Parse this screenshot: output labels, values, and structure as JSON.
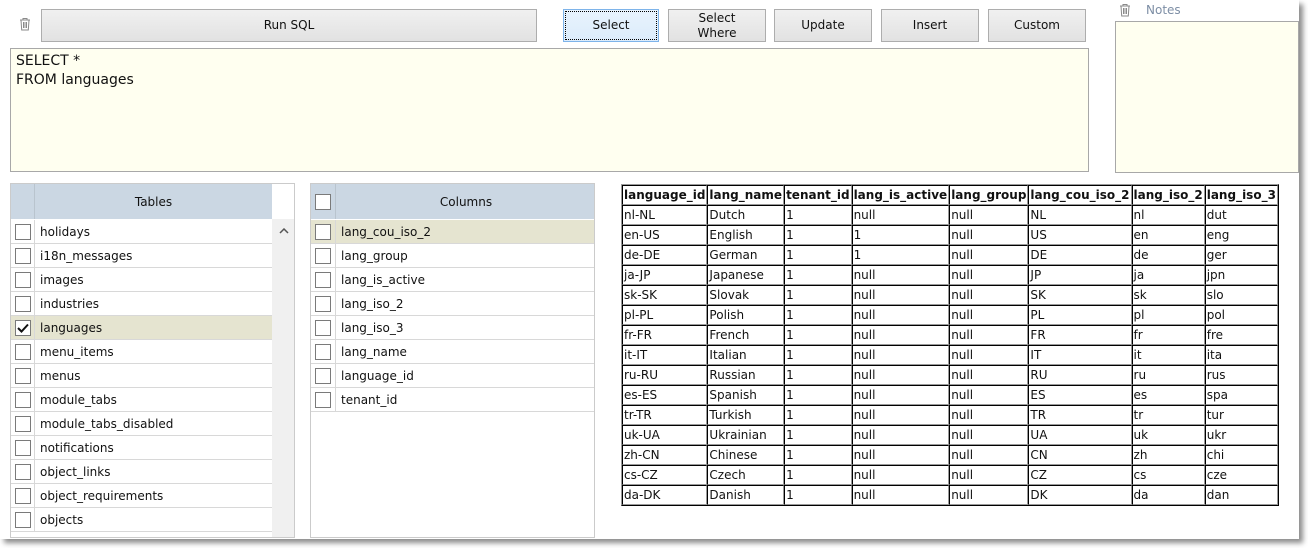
{
  "toolbar": {
    "clear_sql_icon": "trash-icon",
    "run_sql_label": "Run SQL",
    "templates": [
      {
        "label": "Select",
        "active": true
      },
      {
        "label": "Select\nWhere",
        "active": false
      },
      {
        "label": "Update",
        "active": false
      },
      {
        "label": "Insert",
        "active": false
      },
      {
        "label": "Custom",
        "active": false
      }
    ]
  },
  "editor": {
    "sql": "SELECT *\nFROM languages"
  },
  "notes": {
    "clear_icon": "trash-icon",
    "label": "Notes",
    "value": ""
  },
  "tables_panel": {
    "header": "Tables",
    "scroll_up_icon": "chevron-up-icon",
    "items": [
      {
        "name": "holidays",
        "checked": false,
        "selected": false
      },
      {
        "name": "i18n_messages",
        "checked": false,
        "selected": false
      },
      {
        "name": "images",
        "checked": false,
        "selected": false
      },
      {
        "name": "industries",
        "checked": false,
        "selected": false
      },
      {
        "name": "languages",
        "checked": true,
        "selected": true
      },
      {
        "name": "menu_items",
        "checked": false,
        "selected": false
      },
      {
        "name": "menus",
        "checked": false,
        "selected": false
      },
      {
        "name": "module_tabs",
        "checked": false,
        "selected": false
      },
      {
        "name": "module_tabs_disabled",
        "checked": false,
        "selected": false
      },
      {
        "name": "notifications",
        "checked": false,
        "selected": false
      },
      {
        "name": "object_links",
        "checked": false,
        "selected": false
      },
      {
        "name": "object_requirements",
        "checked": false,
        "selected": false
      },
      {
        "name": "objects",
        "checked": false,
        "selected": false
      }
    ]
  },
  "columns_panel": {
    "header": "Columns",
    "select_all_checked": false,
    "items": [
      {
        "name": "lang_cou_iso_2",
        "checked": false,
        "selected": true
      },
      {
        "name": "lang_group",
        "checked": false,
        "selected": false
      },
      {
        "name": "lang_is_active",
        "checked": false,
        "selected": false
      },
      {
        "name": "lang_iso_2",
        "checked": false,
        "selected": false
      },
      {
        "name": "lang_iso_3",
        "checked": false,
        "selected": false
      },
      {
        "name": "lang_name",
        "checked": false,
        "selected": false
      },
      {
        "name": "language_id",
        "checked": false,
        "selected": false
      },
      {
        "name": "tenant_id",
        "checked": false,
        "selected": false
      }
    ]
  },
  "results": {
    "columns": [
      "language_id",
      "lang_name",
      "tenant_id",
      "lang_is_active",
      "lang_group",
      "lang_cou_iso_2",
      "lang_iso_2",
      "lang_iso_3"
    ],
    "rows": [
      [
        "nl-NL",
        "Dutch",
        "1",
        "null",
        "null",
        "NL",
        "nl",
        "dut"
      ],
      [
        "en-US",
        "English",
        "1",
        "1",
        "null",
        "US",
        "en",
        "eng"
      ],
      [
        "de-DE",
        "German",
        "1",
        "1",
        "null",
        "DE",
        "de",
        "ger"
      ],
      [
        "ja-JP",
        "Japanese",
        "1",
        "null",
        "null",
        "JP",
        "ja",
        "jpn"
      ],
      [
        "sk-SK",
        "Slovak",
        "1",
        "null",
        "null",
        "SK",
        "sk",
        "slo"
      ],
      [
        "pl-PL",
        "Polish",
        "1",
        "null",
        "null",
        "PL",
        "pl",
        "pol"
      ],
      [
        "fr-FR",
        "French",
        "1",
        "null",
        "null",
        "FR",
        "fr",
        "fre"
      ],
      [
        "it-IT",
        "Italian",
        "1",
        "null",
        "null",
        "IT",
        "it",
        "ita"
      ],
      [
        "ru-RU",
        "Russian",
        "1",
        "null",
        "null",
        "RU",
        "ru",
        "rus"
      ],
      [
        "es-ES",
        "Spanish",
        "1",
        "null",
        "null",
        "ES",
        "es",
        "spa"
      ],
      [
        "tr-TR",
        "Turkish",
        "1",
        "null",
        "null",
        "TR",
        "tr",
        "tur"
      ],
      [
        "uk-UA",
        "Ukrainian",
        "1",
        "null",
        "null",
        "UA",
        "uk",
        "ukr"
      ],
      [
        "zh-CN",
        "Chinese",
        "1",
        "null",
        "null",
        "CN",
        "zh",
        "chi"
      ],
      [
        "cs-CZ",
        "Czech",
        "1",
        "null",
        "null",
        "CZ",
        "cs",
        "cze"
      ],
      [
        "da-DK",
        "Danish",
        "1",
        "null",
        "null",
        "DK",
        "da",
        "dan"
      ]
    ]
  },
  "colors": {
    "editor_bg": "#fffff0",
    "panel_header_bg": "#cbd7e3",
    "selected_row_bg": "#e5e4d0",
    "active_button_border": "#7eb4ea",
    "notes_label": "#7d8ea5"
  }
}
